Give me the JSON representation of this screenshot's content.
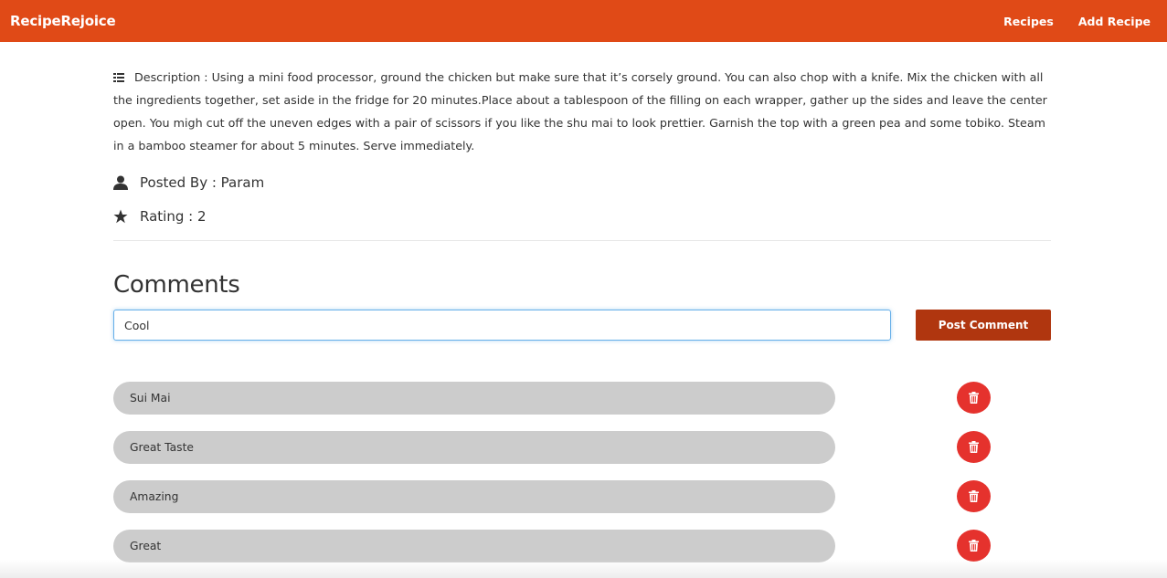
{
  "navbar": {
    "brand": "RecipeRejoice",
    "links": [
      "Recipes",
      "Add Recipe"
    ],
    "color": "#e04a17"
  },
  "recipe": {
    "description": "Description : Using a mini food processor, ground the chicken but make sure that it’s corsely ground. You can also chop with a knife. Mix the chicken with all the ingredients together, set aside in the fridge for 20 minutes.Place about a tablespoon of the filling on each wrapper, gather up the sides and leave the center open. You migh cut off the uneven edges with a pair of scissors if you like the shu mai to look prettier. Garnish the top with a green pea and some tobiko. Steam in a bamboo steamer for about 5 minutes. Serve immediately.",
    "description_icon": "list-icon",
    "posted_by": "Posted By : Param",
    "posted_by_icon": "user-icon",
    "rating": "Rating : 2",
    "rating_icon": "star-icon"
  },
  "comments": {
    "title": "Comments",
    "input_value": "Cool",
    "post_label": "Post Comment",
    "post_color": "#b0360f",
    "delete_color": "#e5322d",
    "delete_icon": "trash-icon",
    "items": [
      "Sui Mai",
      "Great Taste",
      "Amazing",
      "Great"
    ]
  }
}
